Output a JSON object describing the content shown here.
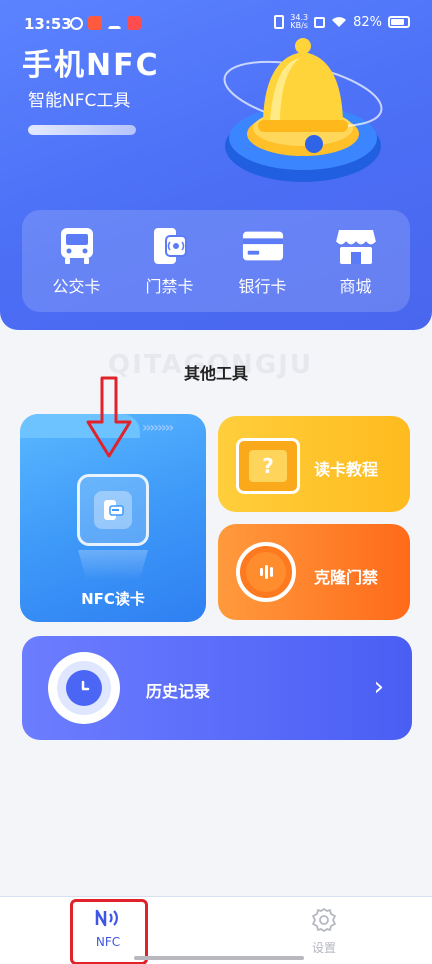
{
  "status_bar": {
    "time": "13:53",
    "net_speed_value": "34.3",
    "net_speed_unit": "KB/s",
    "battery": "82%",
    "battery_level": 0.82
  },
  "header": {
    "title": "手机NFC",
    "subtitle": "智能NFC工具",
    "illustration_icon": "bell-icon"
  },
  "quick_menu": [
    {
      "label": "公交卡",
      "icon": "bus-icon"
    },
    {
      "label": "门禁卡",
      "icon": "access-card-icon"
    },
    {
      "label": "银行卡",
      "icon": "bank-card-icon"
    },
    {
      "label": "商城",
      "icon": "shop-icon"
    }
  ],
  "other_tools": {
    "title": "其他工具",
    "watermark": "QITAGONGJU",
    "nfc_read": {
      "label": "NFC读卡",
      "icon": "nfc-card-reader-icon"
    },
    "tutorial": {
      "label": "读卡教程",
      "icon": "question-icon",
      "icon_text": "?"
    },
    "clone": {
      "label": "克隆门禁",
      "icon": "signal-icon"
    },
    "history": {
      "label": "历史记录",
      "icon": "clock-icon",
      "action_icon": "chevron-right-icon",
      "chevron": "›"
    }
  },
  "bottom_nav": [
    {
      "label": "NFC",
      "icon": "nfc-icon",
      "active": true
    },
    {
      "label": "设置",
      "icon": "gear-icon",
      "active": false
    }
  ],
  "colors": {
    "header_blue": "#4b6ef5",
    "accent_blue": "#3d55e8",
    "tutorial_yellow": "#ffc32b",
    "clone_orange": "#ff7a25",
    "annotation_red": "#e0232a"
  }
}
